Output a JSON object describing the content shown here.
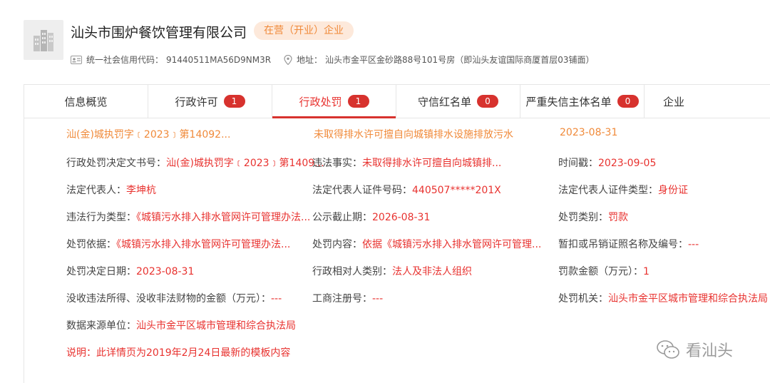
{
  "company": {
    "name": "汕头市围炉餐饮管理有限公司",
    "status": "在营（开业）企业",
    "credit_label": "统一社会信用代码：",
    "credit_code": "91440511MA56D9NM3R",
    "address_label": "地址：",
    "address": "汕头市金平区金砂路88号101号房（即汕头友谊国际商厦首层03铺面）",
    "logo_icon": "building-icon"
  },
  "tabs": [
    {
      "label": "信息概览",
      "count": ""
    },
    {
      "label": "行政许可",
      "count": "1"
    },
    {
      "label": "行政处罚",
      "count": "1"
    },
    {
      "label": "守信红名单",
      "count": "0"
    },
    {
      "label": "严重失信主体名单",
      "count": "0"
    },
    {
      "label": "企业",
      "count": ""
    }
  ],
  "summary": {
    "doc_no": "汕(金)城执罚字﹝2023﹞第14092...",
    "violation": "未取得排水许可擅自向城镇排水设施排放污水",
    "date": "2023-08-31"
  },
  "fields": {
    "decision_doc_label": "行政处罚决定文书号：",
    "decision_doc_value": "汕(金)城执罚字﹝2023﹞第1409...",
    "facts_label": "违法事实：",
    "facts_value": "未取得排水许可擅自向城镇排...",
    "timestamp_label": "时间戳：",
    "timestamp_value": "2023-09-05",
    "legal_rep_label": "法定代表人：",
    "legal_rep_value": "李坤杭",
    "id_no_label": "法定代表人证件号码：",
    "id_no_value": "440507*****201X",
    "id_type_label": "法定代表人证件类型：",
    "id_type_value": "身份证",
    "violation_type_label": "违法行为类型：",
    "violation_type_value": "《城镇污水排入排水管网许可管理办法...",
    "public_deadline_label": "公示截止期：",
    "public_deadline_value": "2026-08-31",
    "penalty_category_label": "处罚类别：",
    "penalty_category_value": "罚款",
    "basis_label": "处罚依据：",
    "basis_value": "《城镇污水排入排水管网许可管理办法...",
    "content_label": "处罚内容：",
    "content_value": "依据《城镇污水排入排水管网许可管理...",
    "license_label": "暂扣或吊销证照名称及编号：",
    "license_value": "---",
    "decision_date_label": "处罚决定日期：",
    "decision_date_value": "2023-08-31",
    "party_type_label": "行政相对人类别：",
    "party_type_value": "法人及非法人组织",
    "fine_label": "罚款金额（万元）：",
    "fine_value": "1",
    "confiscation_label": "没收违法所得、没收非法财物的金额（万元）：",
    "confiscation_value": "---",
    "reg_no_label": "工商注册号：",
    "reg_no_value": "---",
    "authority_label": "处罚机关：",
    "authority_value": "汕头市金平区城市管理和综合执法局",
    "source_label": "数据来源单位：",
    "source_value": "汕头市金平区城市管理和综合执法局"
  },
  "note": "说明：此详情页为2019年2月24日最新的模板内容",
  "watermark": "看汕头",
  "colors": {
    "accent": "#e8322f",
    "orange": "#f08a3a",
    "badge_bg": "#fde9db"
  }
}
